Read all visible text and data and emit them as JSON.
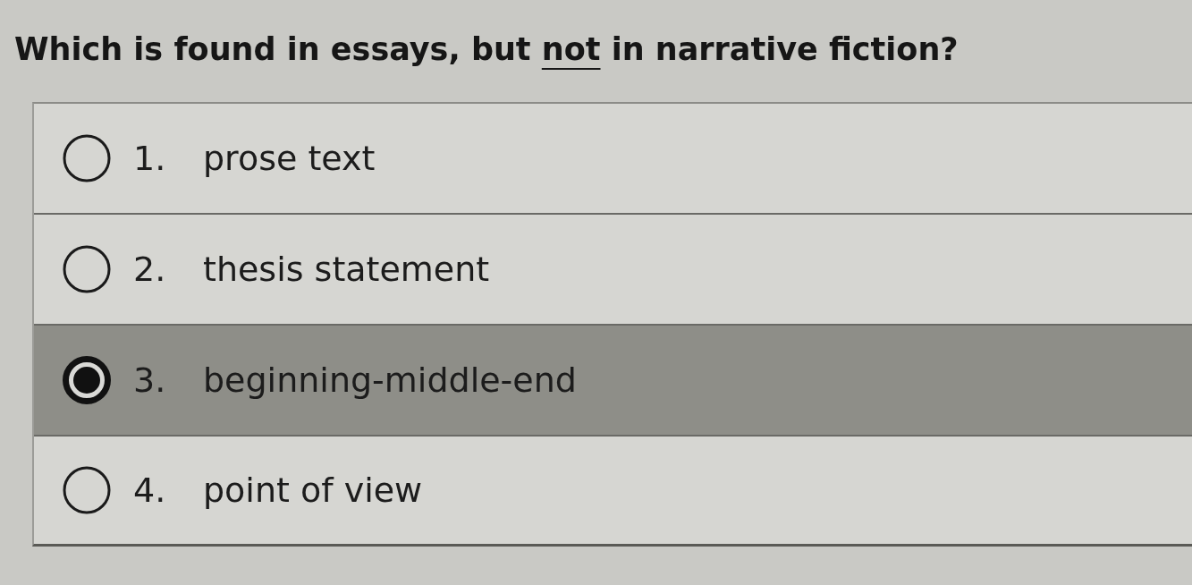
{
  "question": {
    "parts": [
      {
        "kind": "plain",
        "text": "Which is found in essays, but "
      },
      {
        "kind": "underlined",
        "text": "not"
      },
      {
        "kind": "plain",
        "text": " in narrative fiction?"
      }
    ]
  },
  "options": [
    {
      "number": "1.",
      "label": "prose text",
      "selected": false
    },
    {
      "number": "2.",
      "label": "thesis statement",
      "selected": false
    },
    {
      "number": "3.",
      "label": "beginning-middle-end",
      "selected": true
    },
    {
      "number": "4.",
      "label": "point of view",
      "selected": false
    }
  ]
}
